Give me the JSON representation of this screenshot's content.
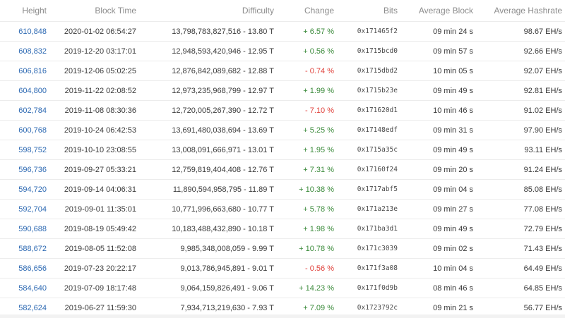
{
  "columns": {
    "height": "Height",
    "block_time": "Block Time",
    "difficulty": "Difficulty",
    "change": "Change",
    "bits": "Bits",
    "average_block": "Average Block",
    "average_hashrate": "Average Hashrate"
  },
  "rows": [
    {
      "height": "610,848",
      "time": "2020-01-02 06:54:27",
      "difficulty": "13,798,783,827,516 - 13.80 T",
      "change": "+ 6.57 %",
      "change_dir": "pos",
      "bits": "0x171465f2",
      "avg_block": "09 min 24 s",
      "hashrate": "98.67 EH/s"
    },
    {
      "height": "608,832",
      "time": "2019-12-20 03:17:01",
      "difficulty": "12,948,593,420,946 - 12.95 T",
      "change": "+ 0.56 %",
      "change_dir": "pos",
      "bits": "0x1715bcd0",
      "avg_block": "09 min 57 s",
      "hashrate": "92.66 EH/s"
    },
    {
      "height": "606,816",
      "time": "2019-12-06 05:02:25",
      "difficulty": "12,876,842,089,682 - 12.88 T",
      "change": "- 0.74 %",
      "change_dir": "neg",
      "bits": "0x1715dbd2",
      "avg_block": "10 min 05 s",
      "hashrate": "92.07 EH/s"
    },
    {
      "height": "604,800",
      "time": "2019-11-22 02:08:52",
      "difficulty": "12,973,235,968,799 - 12.97 T",
      "change": "+ 1.99 %",
      "change_dir": "pos",
      "bits": "0x1715b23e",
      "avg_block": "09 min 49 s",
      "hashrate": "92.81 EH/s"
    },
    {
      "height": "602,784",
      "time": "2019-11-08 08:30:36",
      "difficulty": "12,720,005,267,390 - 12.72 T",
      "change": "- 7.10 %",
      "change_dir": "neg",
      "bits": "0x171620d1",
      "avg_block": "10 min 46 s",
      "hashrate": "91.02 EH/s"
    },
    {
      "height": "600,768",
      "time": "2019-10-24 06:42:53",
      "difficulty": "13,691,480,038,694 - 13.69 T",
      "change": "+ 5.25 %",
      "change_dir": "pos",
      "bits": "0x17148edf",
      "avg_block": "09 min 31 s",
      "hashrate": "97.90 EH/s"
    },
    {
      "height": "598,752",
      "time": "2019-10-10 23:08:55",
      "difficulty": "13,008,091,666,971 - 13.01 T",
      "change": "+ 1.95 %",
      "change_dir": "pos",
      "bits": "0x1715a35c",
      "avg_block": "09 min 49 s",
      "hashrate": "93.11 EH/s"
    },
    {
      "height": "596,736",
      "time": "2019-09-27 05:33:21",
      "difficulty": "12,759,819,404,408 - 12.76 T",
      "change": "+ 7.31 %",
      "change_dir": "pos",
      "bits": "0x17160f24",
      "avg_block": "09 min 20 s",
      "hashrate": "91.24 EH/s"
    },
    {
      "height": "594,720",
      "time": "2019-09-14 04:06:31",
      "difficulty": "11,890,594,958,795 - 11.89 T",
      "change": "+ 10.38 %",
      "change_dir": "pos",
      "bits": "0x1717abf5",
      "avg_block": "09 min 04 s",
      "hashrate": "85.08 EH/s"
    },
    {
      "height": "592,704",
      "time": "2019-09-01 11:35:01",
      "difficulty": "10,771,996,663,680 - 10.77 T",
      "change": "+ 5.78 %",
      "change_dir": "pos",
      "bits": "0x171a213e",
      "avg_block": "09 min 27 s",
      "hashrate": "77.08 EH/s"
    },
    {
      "height": "590,688",
      "time": "2019-08-19 05:49:42",
      "difficulty": "10,183,488,432,890 - 10.18 T",
      "change": "+ 1.98 %",
      "change_dir": "pos",
      "bits": "0x171ba3d1",
      "avg_block": "09 min 49 s",
      "hashrate": "72.79 EH/s"
    },
    {
      "height": "588,672",
      "time": "2019-08-05 11:52:08",
      "difficulty": "9,985,348,008,059 - 9.99 T",
      "change": "+ 10.78 %",
      "change_dir": "pos",
      "bits": "0x171c3039",
      "avg_block": "09 min 02 s",
      "hashrate": "71.43 EH/s"
    },
    {
      "height": "586,656",
      "time": "2019-07-23 20:22:17",
      "difficulty": "9,013,786,945,891 - 9.01 T",
      "change": "- 0.56 %",
      "change_dir": "neg",
      "bits": "0x171f3a08",
      "avg_block": "10 min 04 s",
      "hashrate": "64.49 EH/s"
    },
    {
      "height": "584,640",
      "time": "2019-07-09 18:17:48",
      "difficulty": "9,064,159,826,491 - 9.06 T",
      "change": "+ 14.23 %",
      "change_dir": "pos",
      "bits": "0x171f0d9b",
      "avg_block": "08 min 46 s",
      "hashrate": "64.85 EH/s"
    },
    {
      "height": "582,624",
      "time": "2019-06-27 11:59:30",
      "difficulty": "7,934,713,219,630 - 7.93 T",
      "change": "+ 7.09 %",
      "change_dir": "pos",
      "bits": "0x1723792c",
      "avg_block": "09 min 21 s",
      "hashrate": "56.77 EH/s"
    }
  ],
  "colors": {
    "link": "#2e6ab3",
    "positive": "#3a8a3a",
    "negative": "#e0413b",
    "header_text": "#8c8c8c"
  }
}
